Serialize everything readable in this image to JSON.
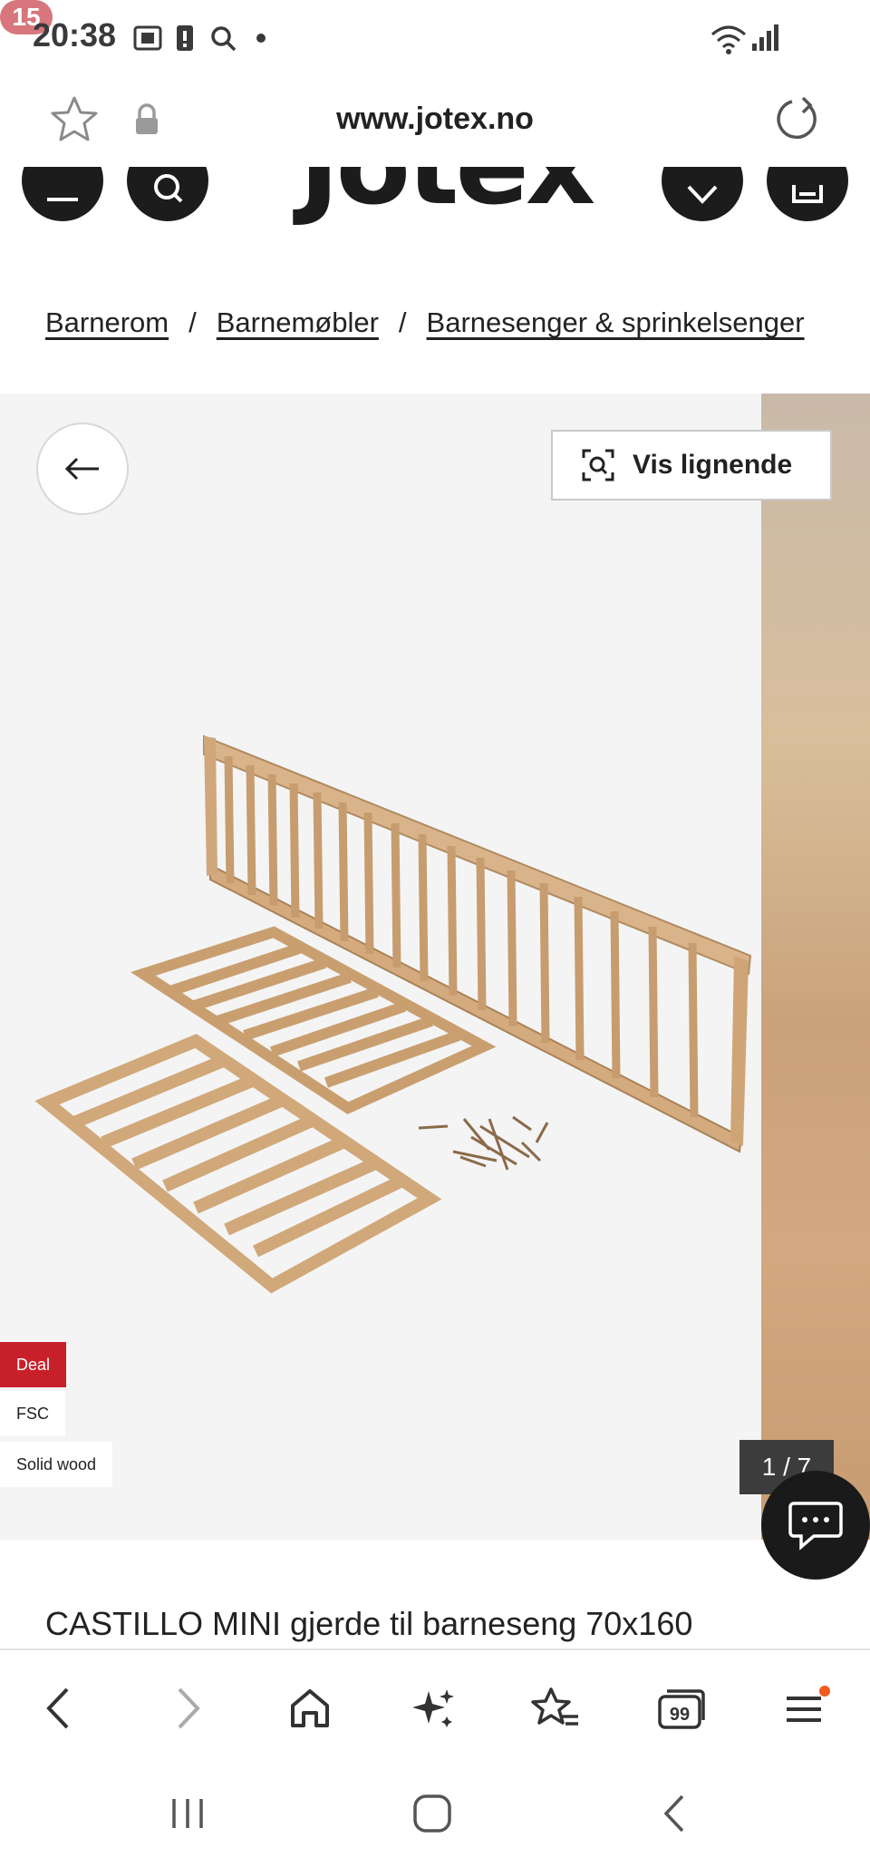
{
  "status_bar": {
    "time": "20:38",
    "battery": "15"
  },
  "url_bar": {
    "url": "www.jotex.no"
  },
  "header": {
    "logo": "Jotex"
  },
  "breadcrumb": {
    "items": [
      "Barnerom",
      "Barnemøbler",
      "Barnesenger & sprinkelsenger"
    ],
    "separator": "/"
  },
  "gallery": {
    "similar_label": "Vis lignende",
    "tags": [
      "Deal",
      "FSC",
      "Solid wood"
    ],
    "counter": "1 / 7",
    "tag_colors": {
      "deal": "#c8202b",
      "default": "#ffffff"
    }
  },
  "product": {
    "title": "CASTILLO MINI gjerde til barneseng 70x160"
  },
  "toolbar": {
    "icons": [
      "back-icon",
      "forward-icon",
      "home-icon",
      "sparkle-icon",
      "bookmark-star-icon",
      "tabs-icon",
      "menu-icon"
    ],
    "tabs_count": "99"
  }
}
